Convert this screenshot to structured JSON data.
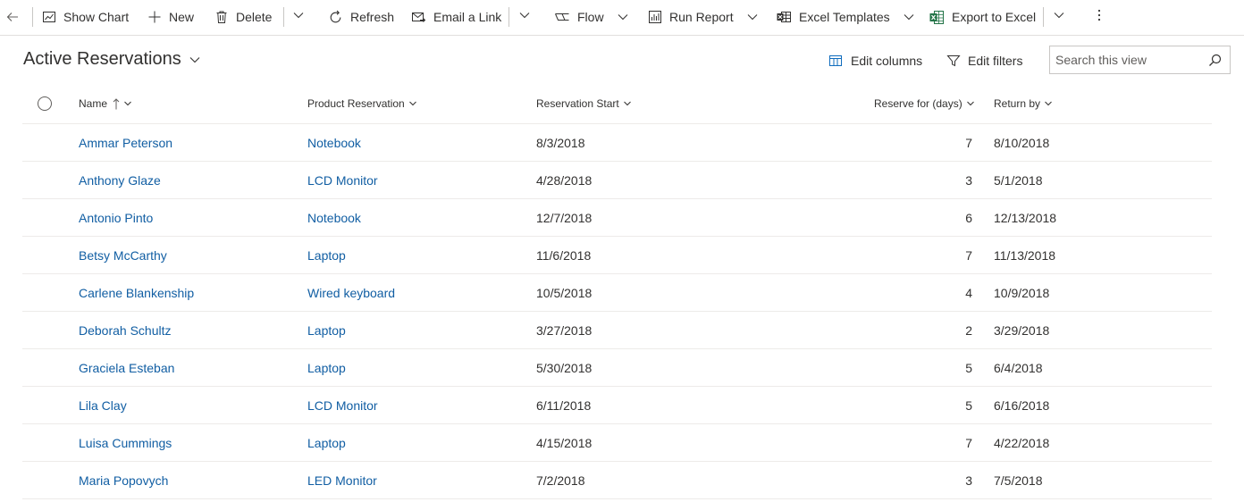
{
  "commandbar": {
    "back_label": "",
    "show_chart": "Show Chart",
    "new": "New",
    "delete": "Delete",
    "refresh": "Refresh",
    "email_link": "Email a Link",
    "flow": "Flow",
    "run_report": "Run Report",
    "excel_templates": "Excel Templates",
    "export_excel": "Export to Excel"
  },
  "view": {
    "title": "Active Reservations",
    "edit_columns": "Edit columns",
    "edit_filters": "Edit filters",
    "search_placeholder": "Search this view"
  },
  "grid": {
    "columns": {
      "name": "Name",
      "product": "Product Reservation",
      "start": "Reservation Start",
      "days": "Reserve for (days)",
      "return_by": "Return by"
    },
    "rows": [
      {
        "name": "Ammar Peterson",
        "product": "Notebook",
        "start": "8/3/2018",
        "days": "7",
        "return_by": "8/10/2018"
      },
      {
        "name": "Anthony Glaze",
        "product": "LCD Monitor",
        "start": "4/28/2018",
        "days": "3",
        "return_by": "5/1/2018"
      },
      {
        "name": "Antonio Pinto",
        "product": "Notebook",
        "start": "12/7/2018",
        "days": "6",
        "return_by": "12/13/2018"
      },
      {
        "name": "Betsy McCarthy",
        "product": "Laptop",
        "start": "11/6/2018",
        "days": "7",
        "return_by": "11/13/2018"
      },
      {
        "name": "Carlene Blankenship",
        "product": "Wired keyboard",
        "start": "10/5/2018",
        "days": "4",
        "return_by": "10/9/2018"
      },
      {
        "name": "Deborah Schultz",
        "product": "Laptop",
        "start": "3/27/2018",
        "days": "2",
        "return_by": "3/29/2018"
      },
      {
        "name": "Graciela Esteban",
        "product": "Laptop",
        "start": "5/30/2018",
        "days": "5",
        "return_by": "6/4/2018"
      },
      {
        "name": "Lila Clay",
        "product": "LCD Monitor",
        "start": "6/11/2018",
        "days": "5",
        "return_by": "6/16/2018"
      },
      {
        "name": "Luisa Cummings",
        "product": "Laptop",
        "start": "4/15/2018",
        "days": "7",
        "return_by": "4/22/2018"
      },
      {
        "name": "Maria Popovych",
        "product": "LED Monitor",
        "start": "7/2/2018",
        "days": "3",
        "return_by": "7/5/2018"
      }
    ]
  },
  "colors": {
    "link": "#115ea3",
    "text": "#323130",
    "excel_green": "#217346",
    "divider": "#edebe9"
  }
}
